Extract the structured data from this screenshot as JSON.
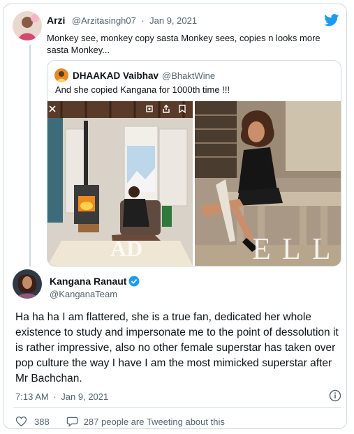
{
  "reply": {
    "author_name": "Arzi",
    "handle": "@Arzitasingh07",
    "separator": "·",
    "date": "Jan 9, 2021",
    "text": "Monkey see, monkey copy sasta Monkey sees, copies n looks more sasta Monkey..."
  },
  "quoted": {
    "author_name": "DHAAKAD Vaibhav",
    "handle": "@BhaktWine",
    "text": "And she copied Kangana for 1000th time !!!",
    "left_photo_watermark": "AD",
    "right_photo_watermark": "ELLI"
  },
  "main": {
    "author_name": "Kangana Ranaut",
    "handle": "@KanganaTeam",
    "text": "Ha ha ha I am flattered, she is a true fan, dedicated her whole existence to study and impersonate me to the point of dessolution it is rather impressive, also no other female superstar has taken over pop culture the way I have I am the most mimicked superstar after Mr Bachchan.",
    "time": "7:13 AM",
    "separator": "·",
    "date": "Jan 9, 2021",
    "like_count": "388",
    "tweeting_text": "287 people are Tweeting about this"
  },
  "colors": {
    "twitter_blue": "#1d9bf0",
    "muted_text": "#536471",
    "border": "#cfd9de"
  },
  "icons": [
    "twitter-bird-icon",
    "verified-badge-icon",
    "info-icon",
    "heart-icon",
    "comment-bubble-icon",
    "close-icon",
    "expand-icon",
    "share-icon",
    "bookmark-icon"
  ]
}
